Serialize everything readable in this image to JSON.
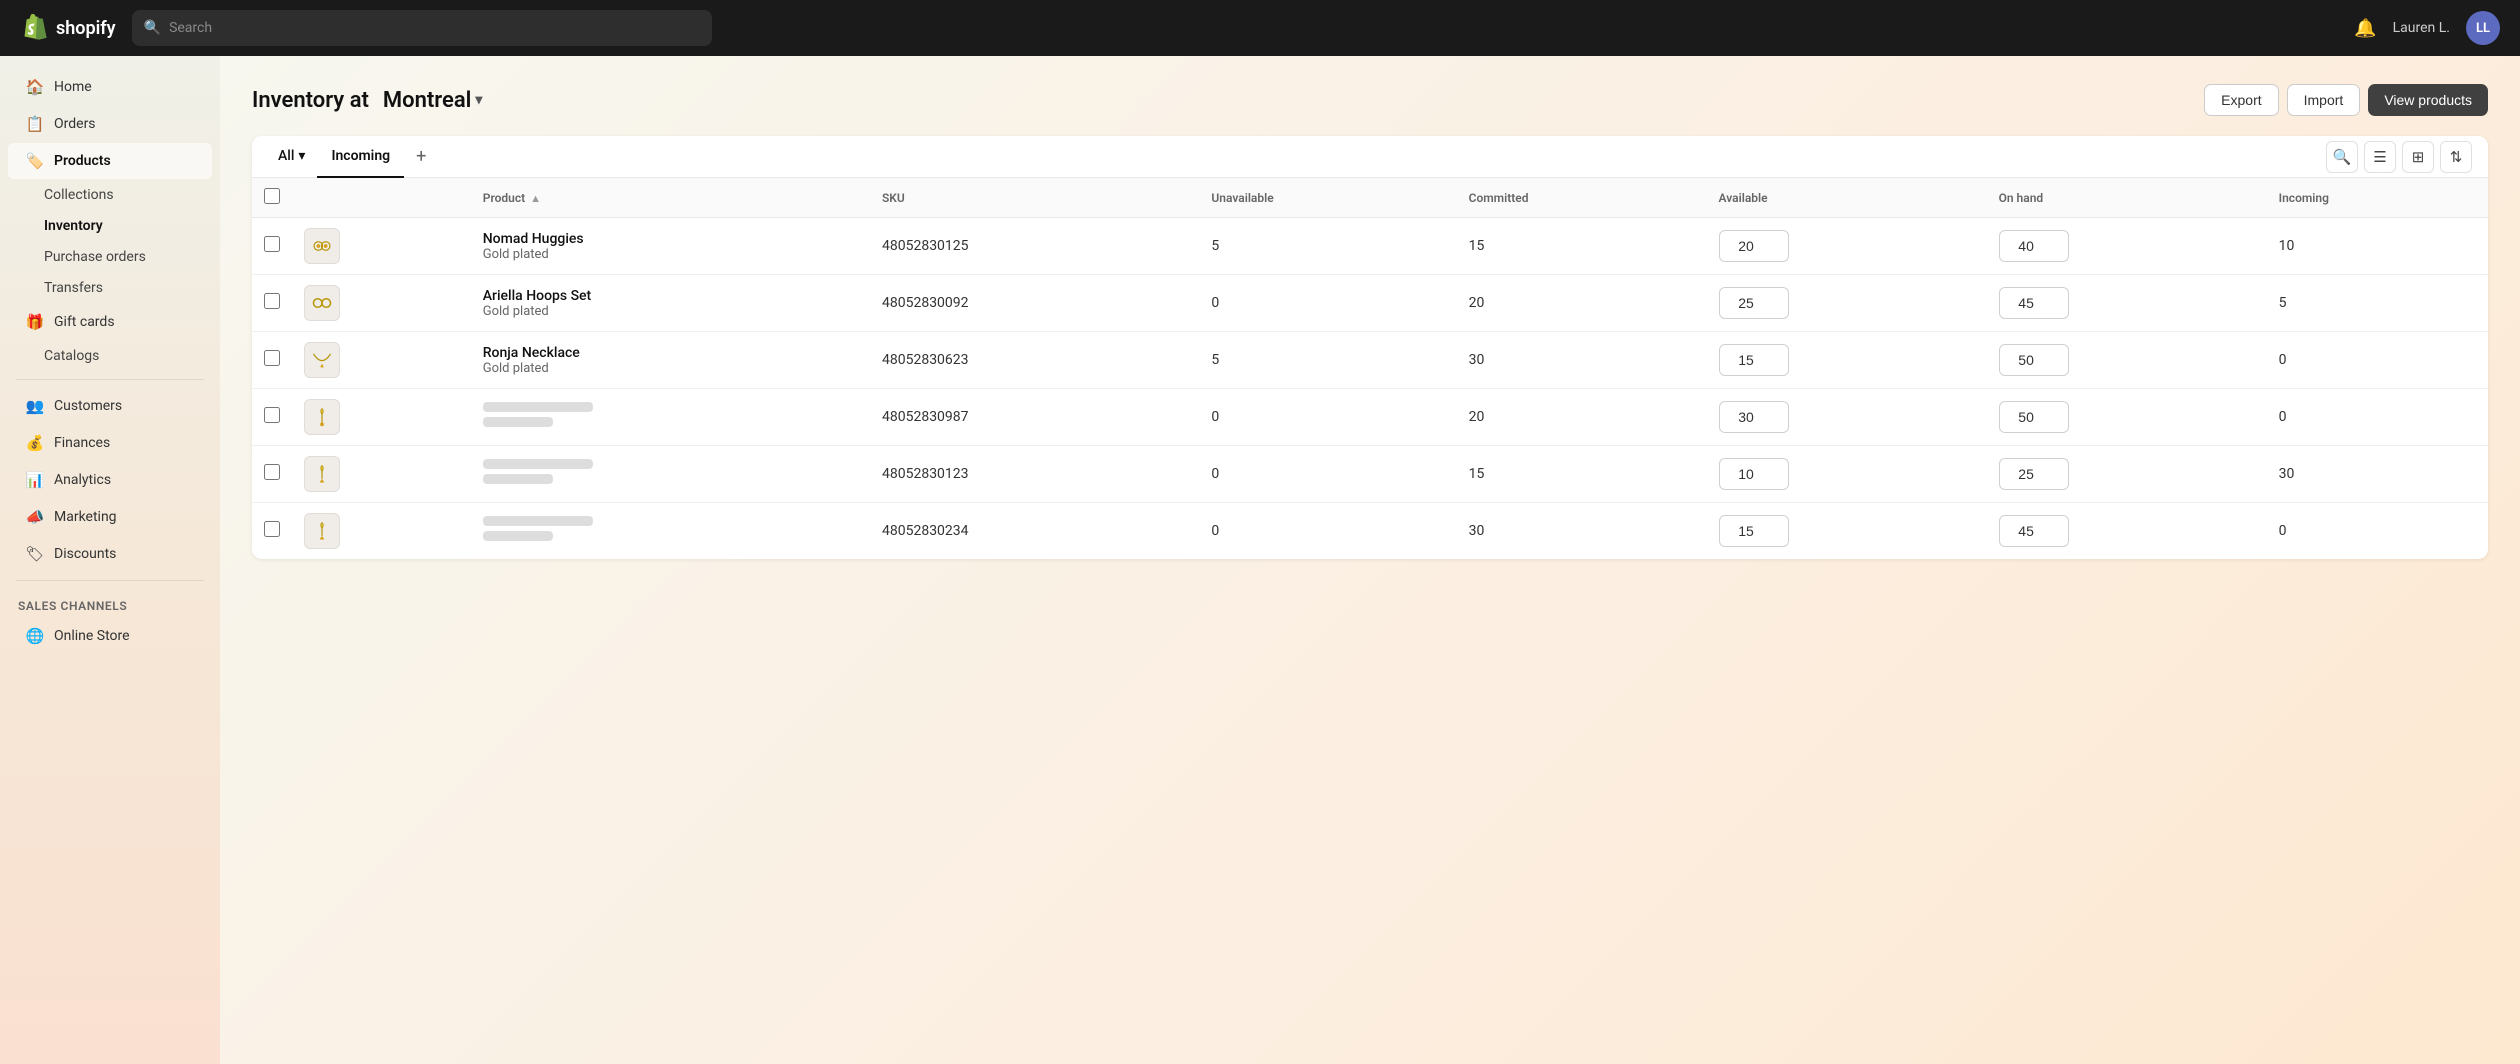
{
  "topnav": {
    "logo_text": "shopify",
    "search_placeholder": "Search",
    "user_name": "Lauren L.",
    "user_initials": "LL"
  },
  "sidebar": {
    "items": [
      {
        "id": "home",
        "label": "Home",
        "icon": "🏠",
        "active": false
      },
      {
        "id": "orders",
        "label": "Orders",
        "icon": "📋",
        "active": false
      },
      {
        "id": "products",
        "label": "Products",
        "icon": "🏷️",
        "active": true
      },
      {
        "id": "collections",
        "label": "Collections",
        "sub": true,
        "active": false
      },
      {
        "id": "inventory",
        "label": "Inventory",
        "sub": true,
        "active": true
      },
      {
        "id": "purchase-orders",
        "label": "Purchase orders",
        "sub": true,
        "active": false
      },
      {
        "id": "transfers",
        "label": "Transfers",
        "sub": true,
        "active": false
      },
      {
        "id": "gift-cards",
        "label": "Gift cards",
        "sub": false,
        "active": false
      },
      {
        "id": "catalogs",
        "label": "Catalogs",
        "sub": true,
        "active": false
      },
      {
        "id": "customers",
        "label": "Customers",
        "icon": "👥",
        "active": false
      },
      {
        "id": "finances",
        "label": "Finances",
        "icon": "💰",
        "active": false
      },
      {
        "id": "analytics",
        "label": "Analytics",
        "icon": "📊",
        "active": false
      },
      {
        "id": "marketing",
        "label": "Marketing",
        "icon": "📣",
        "active": false
      },
      {
        "id": "discounts",
        "label": "Discounts",
        "icon": "🏷",
        "active": false
      }
    ],
    "sales_channels_label": "Sales channels",
    "online_store_label": "Online Store"
  },
  "page": {
    "title_prefix": "Inventory at",
    "location": "Montreal",
    "export_label": "Export",
    "import_label": "Import",
    "view_products_label": "View products"
  },
  "tabs": [
    {
      "id": "all",
      "label": "All",
      "active": false,
      "dropdown": true
    },
    {
      "id": "incoming",
      "label": "Incoming",
      "active": true
    }
  ],
  "table": {
    "columns": [
      {
        "id": "product",
        "label": "Product",
        "sortable": true
      },
      {
        "id": "sku",
        "label": "SKU",
        "sortable": false
      },
      {
        "id": "unavailable",
        "label": "Unavailable",
        "sortable": false
      },
      {
        "id": "committed",
        "label": "Committed",
        "sortable": false
      },
      {
        "id": "available",
        "label": "Available",
        "sortable": false
      },
      {
        "id": "on-hand",
        "label": "On hand",
        "sortable": false
      },
      {
        "id": "incoming",
        "label": "Incoming",
        "sortable": false
      }
    ],
    "rows": [
      {
        "id": "row1",
        "product_name": "Nomad Huggies",
        "product_variant": "Gold plated",
        "sku": "48052830125",
        "unavailable": 5,
        "committed": 15,
        "available": 20,
        "on_hand": 40,
        "incoming": 10,
        "has_image": true,
        "image_type": "huggies"
      },
      {
        "id": "row2",
        "product_name": "Ariella Hoops Set",
        "product_variant": "Gold plated",
        "sku": "48052830092",
        "unavailable": 0,
        "committed": 20,
        "available": 25,
        "on_hand": 45,
        "incoming": 5,
        "has_image": true,
        "image_type": "hoops"
      },
      {
        "id": "row3",
        "product_name": "Ronja Necklace",
        "product_variant": "Gold plated",
        "sku": "48052830623",
        "unavailable": 5,
        "committed": 30,
        "available": 15,
        "on_hand": 50,
        "incoming": 0,
        "has_image": true,
        "image_type": "necklace"
      },
      {
        "id": "row4",
        "product_name": "",
        "product_variant": "",
        "sku": "48052830987",
        "unavailable": 0,
        "committed": 20,
        "available": 30,
        "on_hand": 50,
        "incoming": 0,
        "has_image": false,
        "image_type": "pendant"
      },
      {
        "id": "row5",
        "product_name": "",
        "product_variant": "",
        "sku": "48052830123",
        "unavailable": 0,
        "committed": 15,
        "available": 10,
        "on_hand": 25,
        "incoming": 30,
        "has_image": false,
        "image_type": "pendant2"
      },
      {
        "id": "row6",
        "product_name": "",
        "product_variant": "",
        "sku": "48052830234",
        "unavailable": 0,
        "committed": 30,
        "available": 15,
        "on_hand": 45,
        "incoming": 0,
        "has_image": false,
        "image_type": "pendant3"
      }
    ]
  },
  "icons": {
    "search": "🔍",
    "bell": "🔔",
    "filter": "☰",
    "grid": "⊞",
    "sort": "⇅",
    "magnify": "⌕"
  }
}
